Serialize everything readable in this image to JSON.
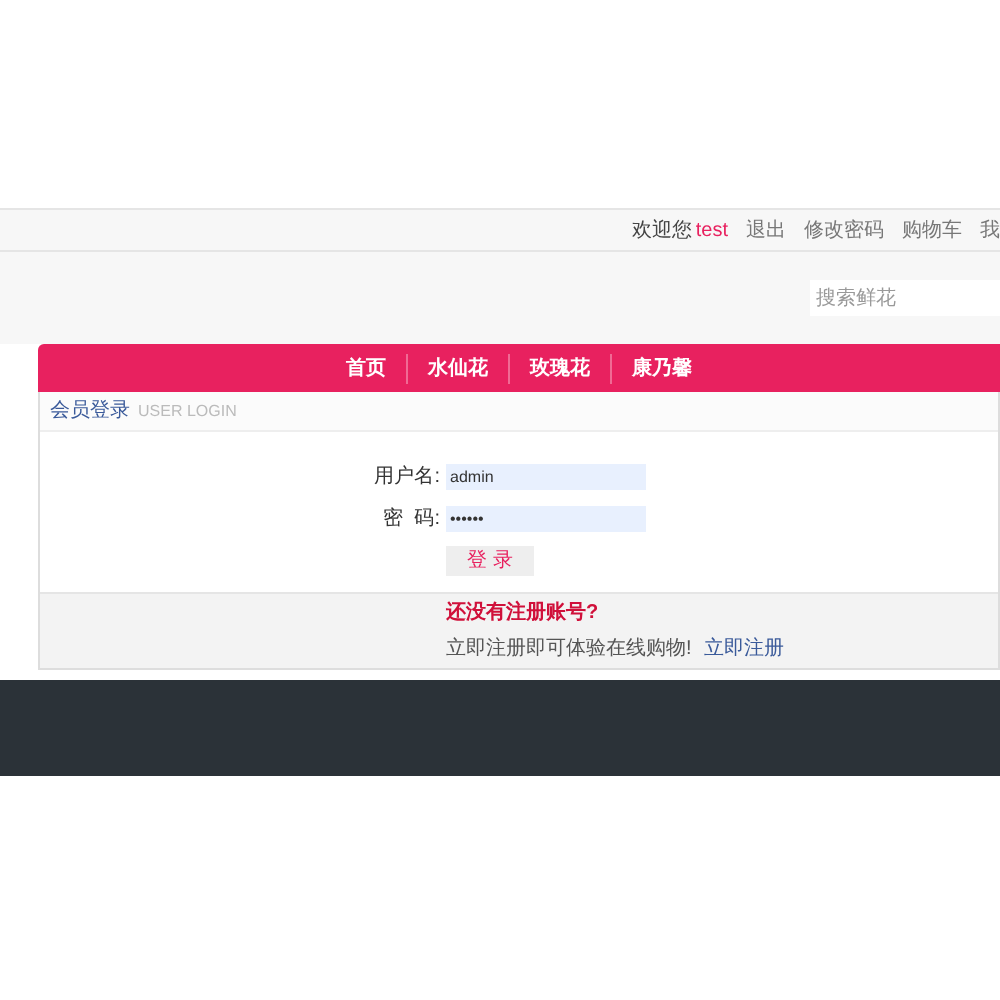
{
  "top_bar": {
    "welcome": "欢迎您",
    "username": "test",
    "links": [
      "退出",
      "修改密码",
      "购物车",
      "我"
    ]
  },
  "search": {
    "placeholder": "搜索鲜花"
  },
  "nav": [
    {
      "label": "首页"
    },
    {
      "label": "水仙花"
    },
    {
      "label": "玫瑰花"
    },
    {
      "label": "康乃馨"
    }
  ],
  "login": {
    "title": "会员登录",
    "subtitle": "USER LOGIN",
    "username_label": "用户名:",
    "username": "admin",
    "password_label": "密  码:",
    "password": "••••••",
    "submit": "登 录",
    "register_heading": "还没有注册账号?",
    "register_text": "立即注册即可体验在线购物!",
    "register_link": "立即注册"
  }
}
